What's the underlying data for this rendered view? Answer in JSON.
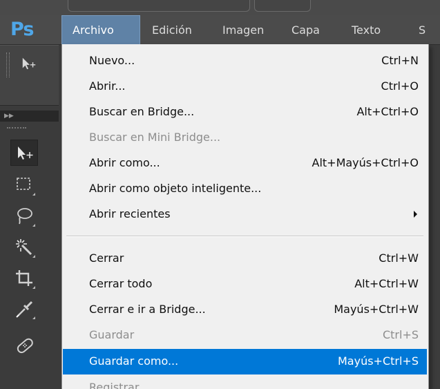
{
  "app": {
    "logo": "Ps"
  },
  "menubar": {
    "items": [
      {
        "label": "Archivo",
        "active": true
      },
      {
        "label": "Edición"
      },
      {
        "label": "Imagen"
      },
      {
        "label": "Capa"
      },
      {
        "label": "Texto"
      },
      {
        "label": "S"
      }
    ]
  },
  "file_menu": {
    "items": [
      {
        "label": "Nuevo...",
        "shortcut": "Ctrl+N"
      },
      {
        "label": "Abrir...",
        "shortcut": "Ctrl+O"
      },
      {
        "label": "Buscar en Bridge...",
        "shortcut": "Alt+Ctrl+O"
      },
      {
        "label": "Buscar en Mini Bridge...",
        "shortcut": "",
        "disabled": true
      },
      {
        "label": "Abrir como...",
        "shortcut": "Alt+Mayús+Ctrl+O"
      },
      {
        "label": "Abrir como objeto inteligente...",
        "shortcut": ""
      },
      {
        "label": "Abrir recientes",
        "shortcut": "",
        "submenu": true
      },
      {
        "label": "Cerrar",
        "shortcut": "Ctrl+W"
      },
      {
        "label": "Cerrar todo",
        "shortcut": "Alt+Ctrl+W"
      },
      {
        "label": "Cerrar e ir a Bridge...",
        "shortcut": "Mayús+Ctrl+W"
      },
      {
        "label": "Guardar",
        "shortcut": "Ctrl+S",
        "disabled": true
      },
      {
        "label": "Guardar como...",
        "shortcut": "Mayús+Ctrl+S",
        "highlighted": true
      },
      {
        "label": "Registrar",
        "shortcut": "",
        "disabled": true
      }
    ]
  },
  "toolbar": {
    "tools": [
      "move-tool-icon",
      "marquee-tool-icon",
      "lasso-tool-icon",
      "magic-wand-icon",
      "crop-tool-icon",
      "eyedropper-icon",
      "healing-brush-icon"
    ]
  },
  "colors": {
    "logo_blue": "#4fa6e7",
    "menu_active": "#5f82a6",
    "highlight": "#0078d7",
    "menu_bg": "#f0f0f0",
    "chrome_dark": "#3c3c3c"
  }
}
